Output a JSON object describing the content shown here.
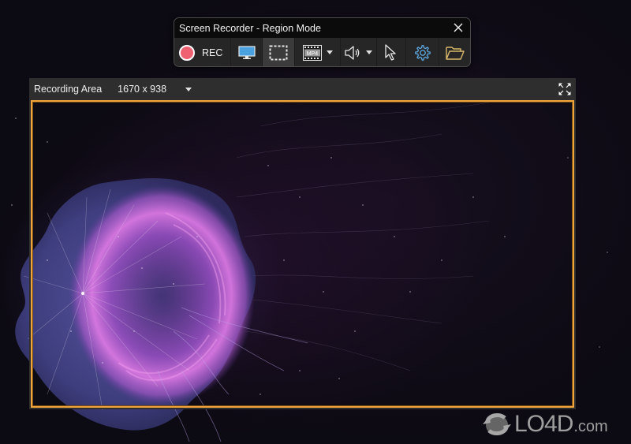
{
  "toolbar": {
    "title": "Screen Recorder - Region Mode",
    "close_icon": "close-icon",
    "rec_label": "REC",
    "buttons": [
      {
        "name": "record-button",
        "icon": "record-icon",
        "label": "REC"
      },
      {
        "name": "fullscreen-mode-button",
        "icon": "monitor-icon"
      },
      {
        "name": "region-mode-button",
        "icon": "dashed-rectangle-icon",
        "active": true
      },
      {
        "name": "format-button",
        "icon": "film-mp4-icon",
        "dropdown": true,
        "format": "MP4"
      },
      {
        "name": "audio-button",
        "icon": "speaker-icon",
        "dropdown": true
      },
      {
        "name": "cursor-button",
        "icon": "cursor-arrow-icon"
      },
      {
        "name": "settings-button",
        "icon": "gear-icon"
      },
      {
        "name": "open-folder-button",
        "icon": "folder-open-icon"
      }
    ],
    "format_label": "MP4",
    "colors": {
      "rec": "#ef6070",
      "monitor": "#4aa3e0",
      "gear": "#5ba3d9",
      "folder": "#d9b86a"
    }
  },
  "recording_area": {
    "label": "Recording Area",
    "size": "1670 x 938",
    "fullscreen_icon": "expand-arrows-icon",
    "frame_color": "#f0a53c"
  },
  "watermark": {
    "brand": "LO4D",
    "domain": ".com"
  }
}
